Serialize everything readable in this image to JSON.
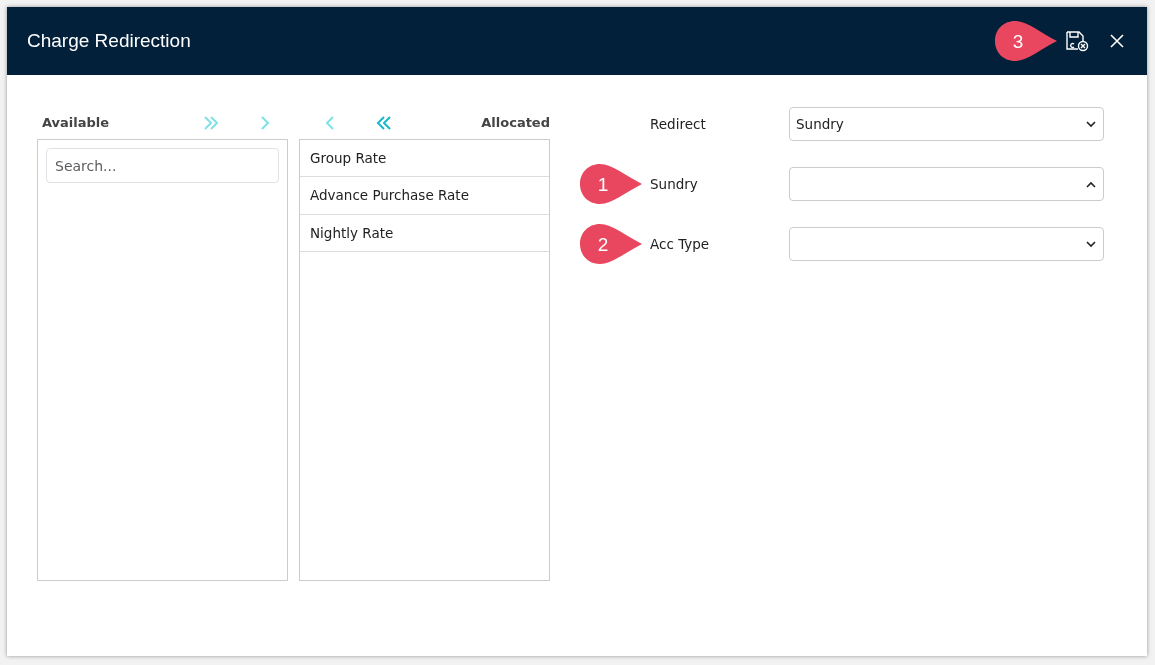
{
  "window": {
    "title": "Charge Redirection",
    "callout": "3"
  },
  "available": {
    "title": "Available",
    "search_placeholder": "Search..."
  },
  "transfer_buttons": [
    {
      "kind": "all-right",
      "enabled": false
    },
    {
      "kind": "right",
      "enabled": false
    },
    {
      "kind": "left",
      "enabled": false
    },
    {
      "kind": "all-left",
      "enabled": true
    }
  ],
  "allocated": {
    "title": "Allocated",
    "items": [
      "Group Rate",
      "Advance Purchase Rate",
      "Nightly Rate"
    ]
  },
  "fields": [
    {
      "label": "Redirect",
      "value": "Sundry",
      "expanded": false
    },
    {
      "label": "Sundry",
      "expanded": true,
      "callout": "1"
    },
    {
      "label": "Acc Type",
      "expanded": false,
      "callout": "2"
    }
  ]
}
